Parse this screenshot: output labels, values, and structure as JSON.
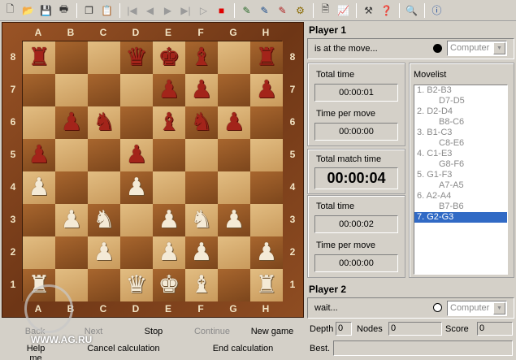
{
  "toolbar": {
    "icons": [
      "new-icon",
      "open-icon",
      "save-icon",
      "print-setup-icon",
      "copy-icon",
      "paste-icon",
      "first-move-icon",
      "back-icon",
      "play-back-icon",
      "forward-icon",
      "last-move-icon",
      "play-icon",
      "stop-icon",
      "edit-icon",
      "board-icon",
      "color-icon",
      "settings-icon",
      "notepad-icon",
      "chart-icon",
      "tools-icon",
      "help-icon",
      "analyze-icon",
      "info-icon"
    ]
  },
  "board": {
    "files": [
      "A",
      "B",
      "C",
      "D",
      "E",
      "F",
      "G",
      "H"
    ],
    "ranks": [
      "8",
      "7",
      "6",
      "5",
      "4",
      "3",
      "2",
      "1"
    ],
    "rows": [
      [
        "r",
        "",
        "",
        "q",
        "k",
        "b",
        "",
        "r"
      ],
      [
        "",
        "",
        "",
        "",
        "p",
        "p",
        "",
        "p"
      ],
      [
        "",
        "p",
        "n",
        "",
        "b",
        "n",
        "p",
        ""
      ],
      [
        "p",
        "",
        "",
        "p",
        "",
        "",
        "",
        ""
      ],
      [
        "P",
        "",
        "",
        "P",
        "",
        "",
        "",
        ""
      ],
      [
        "",
        "P",
        "N",
        "",
        "P",
        "N",
        "P",
        ""
      ],
      [
        "",
        "",
        "P",
        "",
        "P",
        "P",
        "",
        "P"
      ],
      [
        "R",
        "",
        "",
        "Q",
        "K",
        "B",
        "",
        "R"
      ]
    ]
  },
  "player1": {
    "title": "Player 1",
    "status": "is at the move...",
    "type": "Computer",
    "total_time_label": "Total time",
    "total_time": "00:00:01",
    "time_per_move_label": "Time per move",
    "time_per_move": "00:00:00"
  },
  "match": {
    "label": "Total match time",
    "time": "00:00:04"
  },
  "player2": {
    "title": "Player 2",
    "status": "wait...",
    "type": "Computer",
    "total_time_label": "Total time",
    "total_time": "00:00:02",
    "time_per_move_label": "Time per move",
    "time_per_move": "00:00:00"
  },
  "movelist": {
    "title": "Movelist",
    "moves": [
      {
        "white": "1. B2-B3",
        "black": "D7-D5"
      },
      {
        "white": "2. D2-D4",
        "black": "B8-C6"
      },
      {
        "white": "3. B1-C3",
        "black": "C8-E6"
      },
      {
        "white": "4. C1-E3",
        "black": "G8-F6"
      },
      {
        "white": "5. G1-F3",
        "black": "A7-A5"
      },
      {
        "white": "6. A2-A4",
        "black": "B7-B6"
      },
      {
        "white": "7. G2-G3",
        "black": ""
      }
    ],
    "selected_index": 6
  },
  "controls": {
    "back": "Back",
    "next": "Next",
    "stop": "Stop",
    "continue": "Continue",
    "new_game": "New game",
    "help_me": "Help me",
    "cancel_calc": "Cancel calculation",
    "end_calc": "End calculation"
  },
  "stats": {
    "depth_label": "Depth",
    "depth": "0",
    "nodes_label": "Nodes",
    "nodes": "0",
    "score_label": "Score",
    "score": "0",
    "best_label": "Best."
  },
  "watermark": "WWW.AG.RU"
}
